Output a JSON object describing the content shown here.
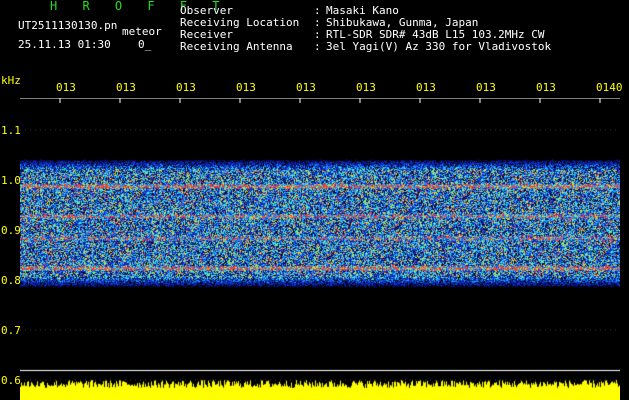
{
  "header": {
    "app_title": "H R O F F T",
    "file_name": "UT2511130130.pn",
    "timestamp": "25.11.13 01:30",
    "tag": "meteor",
    "trailing": "0_"
  },
  "info": [
    {
      "label": "Observer",
      "value": "Masaki Kano"
    },
    {
      "label": "Receiving Location",
      "value": "Shibukawa, Gunma, Japan"
    },
    {
      "label": "Receiver",
      "value": "RTL-SDR SDR# 43dB L15 103.2MHz CW"
    },
    {
      "label": "Receiving Antenna",
      "value": "3el Yagi(V) Az 330 for Vladivostok"
    }
  ],
  "y_unit": "kHz",
  "time_ticks": [
    "013",
    "013",
    "013",
    "013",
    "013",
    "013",
    "013",
    "013",
    "013",
    "0140"
  ],
  "freq_ticks": [
    "1.1",
    "1.0",
    "0.9",
    "0.8",
    "0.7",
    "0.6"
  ],
  "colors": {
    "label": "#ffff00",
    "title": "#22dd22",
    "background": "#000000",
    "noise_low": "#1030c0",
    "noise_mid": "#20a0ff",
    "noise_high": "#30ffff",
    "line_hot": "#ff3030",
    "line_warm": "#ffe000",
    "power_trace": "#ffff00"
  }
}
